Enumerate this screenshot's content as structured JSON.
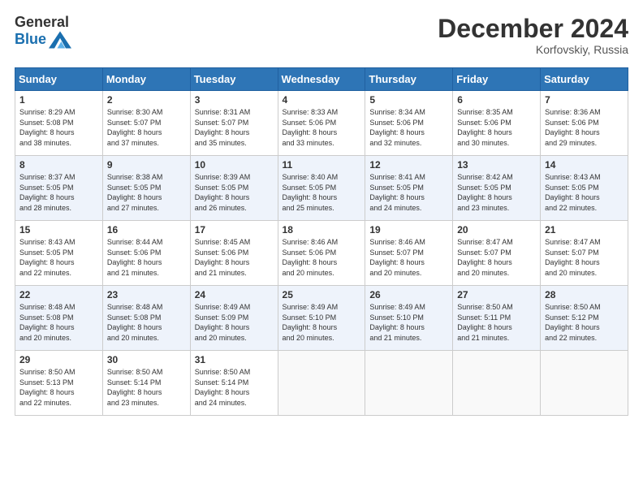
{
  "header": {
    "logo_general": "General",
    "logo_blue": "Blue",
    "month_year": "December 2024",
    "location": "Korfovskiy, Russia"
  },
  "calendar": {
    "headers": [
      "Sunday",
      "Monday",
      "Tuesday",
      "Wednesday",
      "Thursday",
      "Friday",
      "Saturday"
    ],
    "weeks": [
      [
        {
          "day": "1",
          "info": "Sunrise: 8:29 AM\nSunset: 5:08 PM\nDaylight: 8 hours\nand 38 minutes."
        },
        {
          "day": "2",
          "info": "Sunrise: 8:30 AM\nSunset: 5:07 PM\nDaylight: 8 hours\nand 37 minutes."
        },
        {
          "day": "3",
          "info": "Sunrise: 8:31 AM\nSunset: 5:07 PM\nDaylight: 8 hours\nand 35 minutes."
        },
        {
          "day": "4",
          "info": "Sunrise: 8:33 AM\nSunset: 5:06 PM\nDaylight: 8 hours\nand 33 minutes."
        },
        {
          "day": "5",
          "info": "Sunrise: 8:34 AM\nSunset: 5:06 PM\nDaylight: 8 hours\nand 32 minutes."
        },
        {
          "day": "6",
          "info": "Sunrise: 8:35 AM\nSunset: 5:06 PM\nDaylight: 8 hours\nand 30 minutes."
        },
        {
          "day": "7",
          "info": "Sunrise: 8:36 AM\nSunset: 5:06 PM\nDaylight: 8 hours\nand 29 minutes."
        }
      ],
      [
        {
          "day": "8",
          "info": "Sunrise: 8:37 AM\nSunset: 5:05 PM\nDaylight: 8 hours\nand 28 minutes."
        },
        {
          "day": "9",
          "info": "Sunrise: 8:38 AM\nSunset: 5:05 PM\nDaylight: 8 hours\nand 27 minutes."
        },
        {
          "day": "10",
          "info": "Sunrise: 8:39 AM\nSunset: 5:05 PM\nDaylight: 8 hours\nand 26 minutes."
        },
        {
          "day": "11",
          "info": "Sunrise: 8:40 AM\nSunset: 5:05 PM\nDaylight: 8 hours\nand 25 minutes."
        },
        {
          "day": "12",
          "info": "Sunrise: 8:41 AM\nSunset: 5:05 PM\nDaylight: 8 hours\nand 24 minutes."
        },
        {
          "day": "13",
          "info": "Sunrise: 8:42 AM\nSunset: 5:05 PM\nDaylight: 8 hours\nand 23 minutes."
        },
        {
          "day": "14",
          "info": "Sunrise: 8:43 AM\nSunset: 5:05 PM\nDaylight: 8 hours\nand 22 minutes."
        }
      ],
      [
        {
          "day": "15",
          "info": "Sunrise: 8:43 AM\nSunset: 5:05 PM\nDaylight: 8 hours\nand 22 minutes."
        },
        {
          "day": "16",
          "info": "Sunrise: 8:44 AM\nSunset: 5:06 PM\nDaylight: 8 hours\nand 21 minutes."
        },
        {
          "day": "17",
          "info": "Sunrise: 8:45 AM\nSunset: 5:06 PM\nDaylight: 8 hours\nand 21 minutes."
        },
        {
          "day": "18",
          "info": "Sunrise: 8:46 AM\nSunset: 5:06 PM\nDaylight: 8 hours\nand 20 minutes."
        },
        {
          "day": "19",
          "info": "Sunrise: 8:46 AM\nSunset: 5:07 PM\nDaylight: 8 hours\nand 20 minutes."
        },
        {
          "day": "20",
          "info": "Sunrise: 8:47 AM\nSunset: 5:07 PM\nDaylight: 8 hours\nand 20 minutes."
        },
        {
          "day": "21",
          "info": "Sunrise: 8:47 AM\nSunset: 5:07 PM\nDaylight: 8 hours\nand 20 minutes."
        }
      ],
      [
        {
          "day": "22",
          "info": "Sunrise: 8:48 AM\nSunset: 5:08 PM\nDaylight: 8 hours\nand 20 minutes."
        },
        {
          "day": "23",
          "info": "Sunrise: 8:48 AM\nSunset: 5:08 PM\nDaylight: 8 hours\nand 20 minutes."
        },
        {
          "day": "24",
          "info": "Sunrise: 8:49 AM\nSunset: 5:09 PM\nDaylight: 8 hours\nand 20 minutes."
        },
        {
          "day": "25",
          "info": "Sunrise: 8:49 AM\nSunset: 5:10 PM\nDaylight: 8 hours\nand 20 minutes."
        },
        {
          "day": "26",
          "info": "Sunrise: 8:49 AM\nSunset: 5:10 PM\nDaylight: 8 hours\nand 21 minutes."
        },
        {
          "day": "27",
          "info": "Sunrise: 8:50 AM\nSunset: 5:11 PM\nDaylight: 8 hours\nand 21 minutes."
        },
        {
          "day": "28",
          "info": "Sunrise: 8:50 AM\nSunset: 5:12 PM\nDaylight: 8 hours\nand 22 minutes."
        }
      ],
      [
        {
          "day": "29",
          "info": "Sunrise: 8:50 AM\nSunset: 5:13 PM\nDaylight: 8 hours\nand 22 minutes."
        },
        {
          "day": "30",
          "info": "Sunrise: 8:50 AM\nSunset: 5:14 PM\nDaylight: 8 hours\nand 23 minutes."
        },
        {
          "day": "31",
          "info": "Sunrise: 8:50 AM\nSunset: 5:14 PM\nDaylight: 8 hours\nand 24 minutes."
        },
        {
          "day": "",
          "info": ""
        },
        {
          "day": "",
          "info": ""
        },
        {
          "day": "",
          "info": ""
        },
        {
          "day": "",
          "info": ""
        }
      ]
    ]
  }
}
